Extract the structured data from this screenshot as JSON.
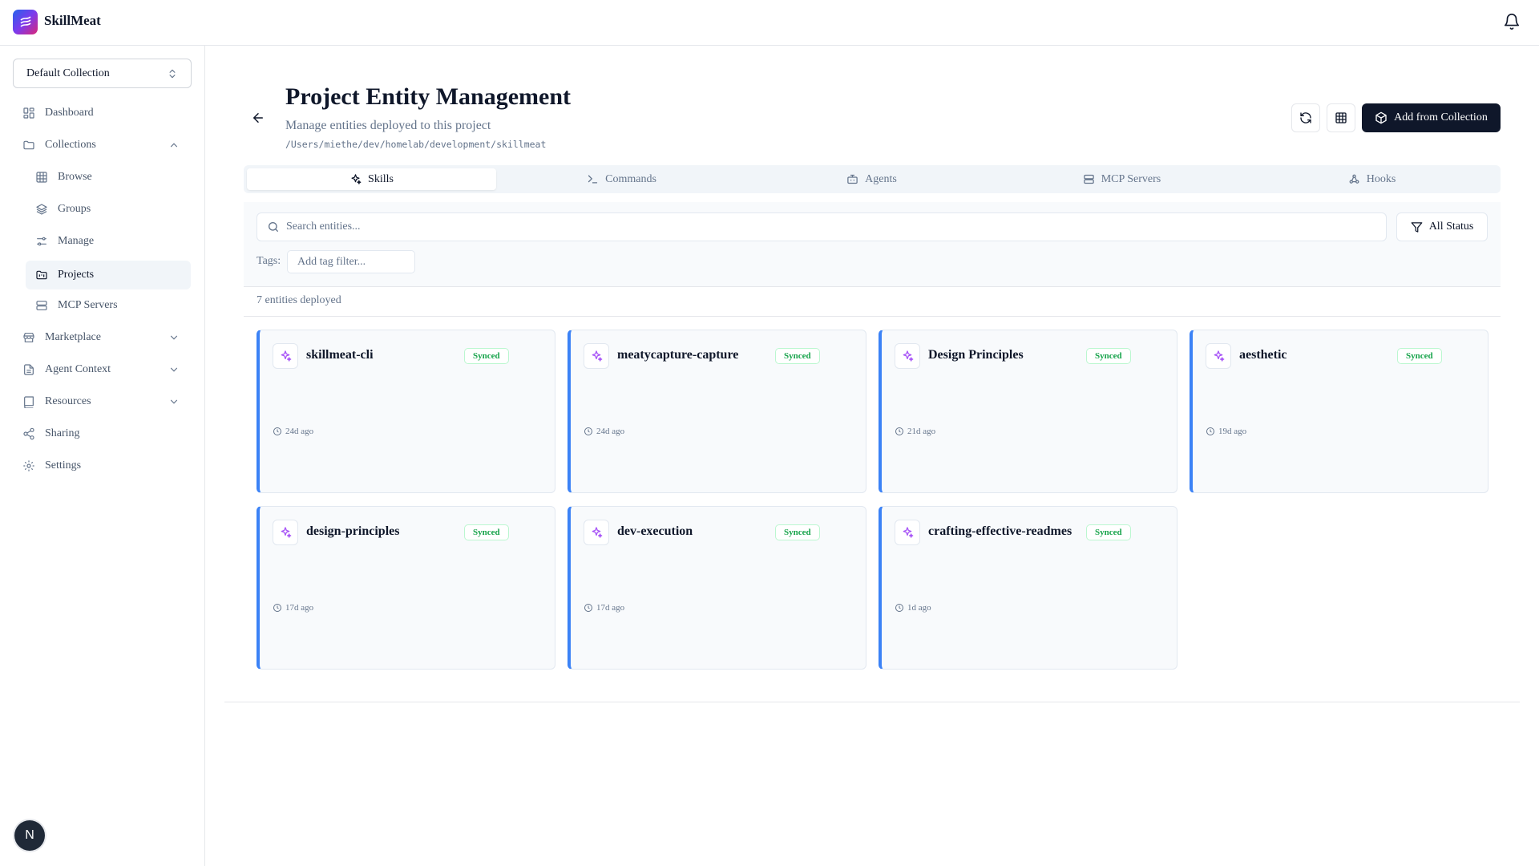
{
  "app": {
    "name": "SkillMeat"
  },
  "sidebar": {
    "collection_select": "Default Collection",
    "items": [
      {
        "label": "Dashboard",
        "icon": "dashboard-icon"
      },
      {
        "label": "Collections",
        "icon": "folder-icon"
      },
      {
        "label": "Browse",
        "icon": "grid-icon"
      },
      {
        "label": "Groups",
        "icon": "layers-icon"
      },
      {
        "label": "Manage",
        "icon": "sliders-icon"
      },
      {
        "label": "Projects",
        "icon": "folder-kanban-icon"
      },
      {
        "label": "MCP Servers",
        "icon": "server-icon"
      },
      {
        "label": "Marketplace",
        "icon": "store-icon"
      },
      {
        "label": "Agent Context",
        "icon": "file-text-icon"
      },
      {
        "label": "Resources",
        "icon": "book-icon"
      },
      {
        "label": "Sharing",
        "icon": "share-icon"
      },
      {
        "label": "Settings",
        "icon": "settings-icon"
      }
    ],
    "avatar_letter": "N"
  },
  "header": {
    "title": "Project Entity Management",
    "subtitle": "Manage entities deployed to this project",
    "path": "/Users/miethe/dev/homelab/development/skillmeat",
    "add_button": "Add from Collection"
  },
  "tabs": [
    {
      "label": "Skills",
      "icon": "sparkles-icon",
      "active": true
    },
    {
      "label": "Commands",
      "icon": "terminal-icon",
      "active": false
    },
    {
      "label": "Agents",
      "icon": "bot-icon",
      "active": false
    },
    {
      "label": "MCP Servers",
      "icon": "server-icon",
      "active": false
    },
    {
      "label": "Hooks",
      "icon": "webhook-icon",
      "active": false
    }
  ],
  "filters": {
    "search_placeholder": "Search entities...",
    "status_button": "All Status",
    "tags_label": "Tags:",
    "tag_placeholder": "Add tag filter..."
  },
  "entity_count": "7 entities deployed",
  "entities": [
    {
      "name": "skillmeat-cli",
      "status": "Synced",
      "time": "24d ago"
    },
    {
      "name": "meatycapture-capture",
      "status": "Synced",
      "time": "24d ago"
    },
    {
      "name": "Design Principles",
      "status": "Synced",
      "time": "21d ago"
    },
    {
      "name": "aesthetic",
      "status": "Synced",
      "time": "19d ago"
    },
    {
      "name": "design-principles",
      "status": "Synced",
      "time": "17d ago"
    },
    {
      "name": "dev-execution",
      "status": "Synced",
      "time": "17d ago"
    },
    {
      "name": "crafting-effective-readmes",
      "status": "Synced",
      "time": "1d ago"
    }
  ],
  "colors": {
    "primary": "#0f172a",
    "accent_border": "#3b82f6",
    "synced": "#16a34a",
    "skill_icon": "#a855f7"
  }
}
